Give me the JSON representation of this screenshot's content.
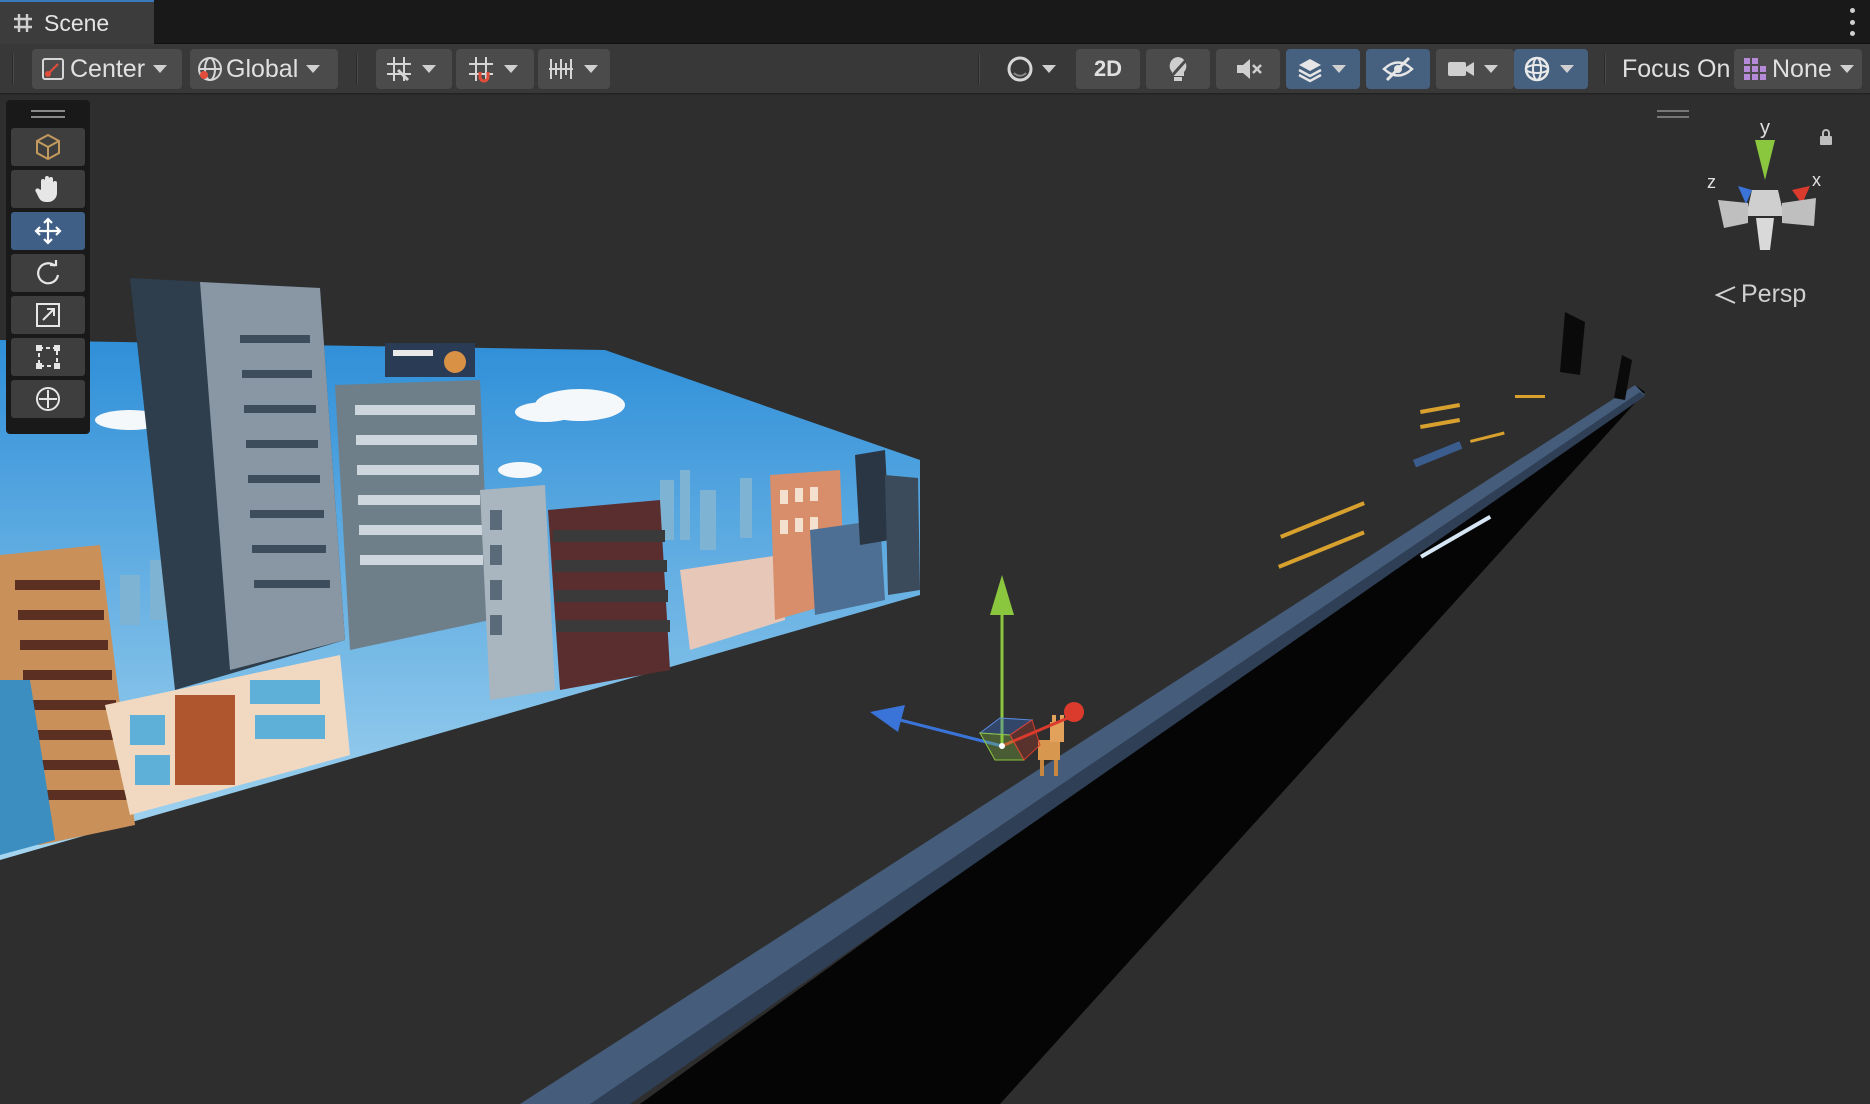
{
  "tab": {
    "label": "Scene",
    "icon": "grid-hash-icon"
  },
  "toolbar": {
    "pivot_label": "Center",
    "space_label": "Global",
    "mode_2d_label": "2D",
    "focus_on_label": "Focus On",
    "focus_value": "None"
  },
  "tools": {
    "items": [
      "view-cube-icon",
      "hand-tool-icon",
      "move-tool-icon",
      "rotate-tool-icon",
      "scale-tool-icon",
      "rect-tool-icon",
      "transform-tool-icon"
    ],
    "active": "move-tool-icon"
  },
  "gizmo": {
    "y_label": "y",
    "x_label": "x",
    "z_label": "z",
    "projection_label": "Persp",
    "colors": {
      "x": "#db3b2c",
      "y": "#8bc63f",
      "z": "#3a74d8"
    }
  },
  "colors": {
    "accent": "#3a79bb",
    "active_button": "#46607f",
    "viewport_bg": "#2e2e2e"
  }
}
